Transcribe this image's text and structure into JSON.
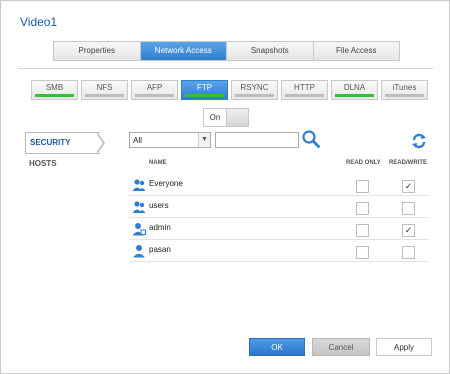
{
  "title": "Video1",
  "tabs": [
    {
      "label": "Properties",
      "active": false
    },
    {
      "label": "Network Access",
      "active": true
    },
    {
      "label": "Snapshots",
      "active": false
    },
    {
      "label": "File Access",
      "active": false
    }
  ],
  "protocols": [
    {
      "label": "SMB",
      "enabled": true,
      "active": false
    },
    {
      "label": "NFS",
      "enabled": false,
      "active": false
    },
    {
      "label": "AFP",
      "enabled": false,
      "active": false
    },
    {
      "label": "FTP",
      "enabled": true,
      "active": true
    },
    {
      "label": "RSYNC",
      "enabled": false,
      "active": false
    },
    {
      "label": "HTTP",
      "enabled": false,
      "active": false
    },
    {
      "label": "DLNA",
      "enabled": true,
      "active": false
    },
    {
      "label": "iTunes",
      "enabled": false,
      "active": false
    }
  ],
  "toggle": {
    "label": "On"
  },
  "sidebar": {
    "security": "SECURITY",
    "hosts": "HOSTS"
  },
  "filter": {
    "selected": "All",
    "search_value": ""
  },
  "table": {
    "headers": {
      "name": "NAME",
      "read_only": "READ ONLY",
      "read_write": "READ/WRITE"
    },
    "rows": [
      {
        "name": "Everyone",
        "type": "group",
        "read_only": false,
        "read_write": true
      },
      {
        "name": "users",
        "type": "group",
        "read_only": false,
        "read_write": false
      },
      {
        "name": "admin",
        "type": "admin-user",
        "read_only": false,
        "read_write": true
      },
      {
        "name": "pasan",
        "type": "user",
        "read_only": false,
        "read_write": false
      }
    ]
  },
  "buttons": {
    "ok": "OK",
    "cancel": "Cancel",
    "apply": "Apply"
  },
  "colors": {
    "accent": "#2f7fd0",
    "title": "#1a5aa8",
    "enabled_bar": "#33c233",
    "disabled_bar": "#bdbdbd"
  }
}
